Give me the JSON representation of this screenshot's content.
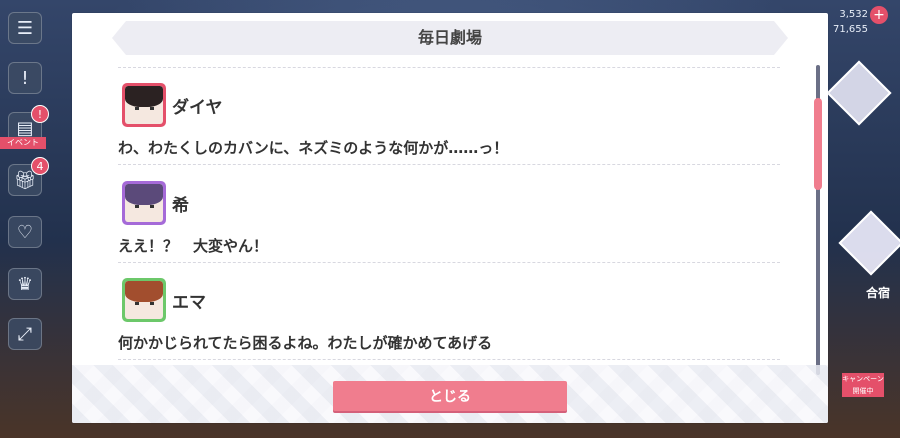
{
  "modal": {
    "title": "毎日劇場",
    "close_label": "とじる"
  },
  "dialog": [
    {
      "speaker": "ダイヤ",
      "line": "わ、わたくしのカバンに、ネズミのような何かが……っ！",
      "frame_color": "#e4506a",
      "hair_color": "#2b2222"
    },
    {
      "speaker": "希",
      "line": "ええ！？　大変やん！",
      "frame_color": "#a56ad8",
      "hair_color": "#5b4a7a"
    },
    {
      "speaker": "エマ",
      "line": "何かかじられてたら困るよね。わたしが確かめてあげる",
      "frame_color": "#6cc86a",
      "hair_color": "#a24e2e"
    }
  ],
  "side_menu": {
    "event_tag": "イベント",
    "badge_1": "!",
    "badge_2": "4"
  },
  "resources": {
    "value_1": "3,532",
    "value_2": "71,655"
  },
  "right_panel": {
    "label": "合宿",
    "campaign_tag": "キャンペーン開催中"
  },
  "colors": {
    "accent": "#f07d8e",
    "header_bg": "#ededf3"
  }
}
